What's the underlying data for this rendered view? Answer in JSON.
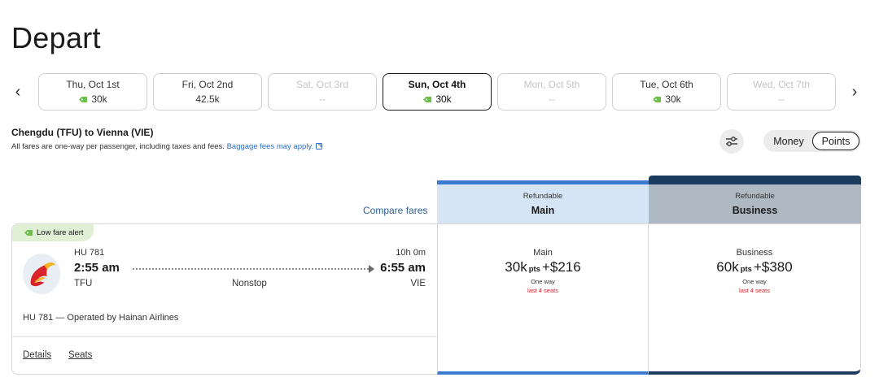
{
  "page": {
    "title": "Depart"
  },
  "dates": [
    {
      "label": "Thu, Oct 1st",
      "price": "30k",
      "tag": true,
      "state": "normal"
    },
    {
      "label": "Fri, Oct 2nd",
      "price": "42.5k",
      "tag": false,
      "state": "normal"
    },
    {
      "label": "Sat, Oct 3rd",
      "price": "--",
      "tag": false,
      "state": "disabled"
    },
    {
      "label": "Sun, Oct 4th",
      "price": "30k",
      "tag": true,
      "state": "selected"
    },
    {
      "label": "Mon, Oct 5th",
      "price": "--",
      "tag": false,
      "state": "disabled"
    },
    {
      "label": "Tue, Oct 6th",
      "price": "30k",
      "tag": true,
      "state": "normal"
    },
    {
      "label": "Wed, Oct 7th",
      "price": "--",
      "tag": false,
      "state": "disabled"
    }
  ],
  "nav": {
    "prev": "‹",
    "next": "›"
  },
  "route": {
    "title": "Chengdu (TFU) to Vienna (VIE)",
    "note": "All fares are one-way per passenger, including taxes and fees.",
    "baggage_link": "Baggage fees may apply."
  },
  "toggle": {
    "money": "Money",
    "points": "Points",
    "selected": "Points"
  },
  "compare": {
    "label": "Compare fares"
  },
  "columns": {
    "main": {
      "sub": "Refundable",
      "name": "Main"
    },
    "business": {
      "sub": "Refundable",
      "name": "Business"
    }
  },
  "flight": {
    "alert": "Low fare alert",
    "flight_no": "HU 781",
    "duration": "10h 0m",
    "dep_time": "2:55 am",
    "arr_time": "6:55 am",
    "dep_code": "TFU",
    "arr_code": "VIE",
    "stops": "Nonstop",
    "operated_by": "HU 781 — Operated by Hainan Airlines",
    "details": "Details",
    "seats": "Seats"
  },
  "fares": {
    "main": {
      "name": "Main",
      "points": "30k",
      "pts_label": "pts",
      "plus": "+",
      "cash": "$216",
      "oneway": "One way",
      "seats_left": "last 4 seats"
    },
    "business": {
      "name": "Business",
      "points": "60k",
      "pts_label": "pts",
      "plus": "+",
      "cash": "$380",
      "oneway": "One way",
      "seats_left": "last 4 seats"
    }
  },
  "colors": {
    "accent_blue": "#3b7bd1",
    "business_navy": "#1c3c5e",
    "alert_green": "#dff0d4",
    "seat_red": "#d0232b",
    "link_blue": "#2a6fc4"
  },
  "icons": {
    "tag": "price-tag-icon",
    "filter": "sliders-icon",
    "external": "external-link-icon"
  }
}
